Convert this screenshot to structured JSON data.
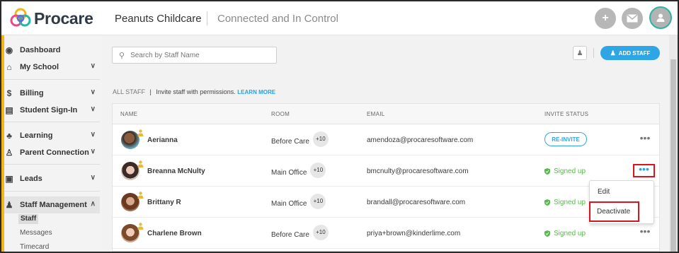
{
  "header": {
    "brand": "Procare",
    "center_name": "Peanuts Childcare",
    "tagline": "Connected and In Control",
    "icons": [
      "plus-circle-icon",
      "mail-icon",
      "user-avatar-icon"
    ]
  },
  "sidebar": {
    "items": [
      {
        "label": "Dashboard",
        "icon": "dashboard-icon",
        "has_chevron": false
      },
      {
        "label": "My School",
        "icon": "school-icon",
        "has_chevron": true
      },
      {
        "label": "Billing",
        "icon": "billing-icon",
        "has_chevron": true
      },
      {
        "label": "Student Sign-In",
        "icon": "signin-icon",
        "has_chevron": true
      },
      {
        "label": "Learning",
        "icon": "learning-icon",
        "has_chevron": true
      },
      {
        "label": "Parent Connection",
        "icon": "family-icon",
        "has_chevron": true
      },
      {
        "label": "Leads",
        "icon": "leads-icon",
        "has_chevron": true
      },
      {
        "label": "Staff Management",
        "icon": "staff-icon",
        "has_chevron": true,
        "expanded": true
      }
    ],
    "sub_items": [
      {
        "label": "Staff",
        "active": true
      },
      {
        "label": "Messages",
        "active": false
      },
      {
        "label": "Timecard",
        "active": false
      }
    ]
  },
  "toolbar": {
    "search_placeholder": "Search by Staff Name",
    "add_staff_label": "ADD STAFF"
  },
  "permission_line": {
    "all_staff": "ALL STAFF",
    "separator": "|",
    "text": "Invite staff with permissions.",
    "link": "LEARN MORE"
  },
  "table": {
    "columns": [
      "NAME",
      "ROOM",
      "EMAIL",
      "INVITE STATUS"
    ],
    "rows": [
      {
        "name": "Aerianna",
        "room": "Before Care",
        "room_extra": "+10",
        "email": "amendoza@procaresoftware.com",
        "status": "RE-INVITE",
        "status_type": "button"
      },
      {
        "name": "Breanna McNulty",
        "room": "Main Office",
        "room_extra": "+10",
        "email": "bmcnulty@procaresoftware.com",
        "status": "Signed up",
        "status_type": "signed"
      },
      {
        "name": "Brittany R",
        "room": "Main Office",
        "room_extra": "+10",
        "email": "brandall@procaresoftware.com",
        "status": "Signed up",
        "status_type": "signed"
      },
      {
        "name": "Charlene Brown",
        "room": "Before Care",
        "room_extra": "+10",
        "email": "priya+brown@kinderlime.com",
        "status": "Signed up",
        "status_type": "signed"
      }
    ],
    "more_label": "•••"
  },
  "row_menu": {
    "items": [
      "Edit",
      "Deactivate"
    ]
  },
  "colors": {
    "accent_blue": "#2ea6e6",
    "signed_green": "#58b94b",
    "sidebar_accent": "#f2b61b",
    "highlight_red": "#d7161b"
  }
}
